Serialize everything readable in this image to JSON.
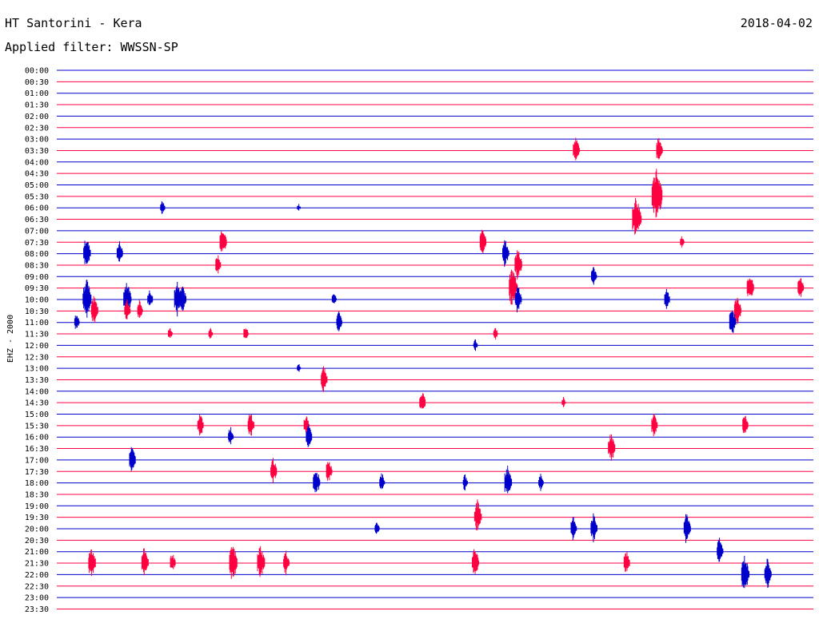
{
  "header": {
    "station": "HT Santorini - Kera",
    "date": "2018-04-02",
    "filter": "Applied filter: WWSSN-SP"
  },
  "chart_data": {
    "type": "line",
    "title": "HT Santorini - Kera",
    "subtitle": "Applied filter: WWSSN-SP",
    "ylabel": "EHZ - 2000",
    "xlabel": "",
    "time_lines": [
      "00:00",
      "00:30",
      "01:00",
      "01:30",
      "02:00",
      "02:30",
      "03:00",
      "03:30",
      "04:00",
      "04:30",
      "05:00",
      "05:30",
      "06:00",
      "06:30",
      "07:00",
      "07:30",
      "08:00",
      "08:30",
      "09:00",
      "09:30",
      "10:00",
      "10:30",
      "11:00",
      "11:30",
      "12:00",
      "12:30",
      "13:00",
      "13:30",
      "14:00",
      "14:30",
      "15:00",
      "15:30",
      "16:00",
      "16:30",
      "17:00",
      "17:30",
      "18:00",
      "18:30",
      "19:00",
      "19:30",
      "20:00",
      "20:30",
      "21:00",
      "21:30",
      "22:00",
      "22:30",
      "23:00",
      "23:30"
    ],
    "line_colors": [
      "#0000cc",
      "#ff0040"
    ],
    "x_range_minutes": [
      0,
      30
    ],
    "grid": false,
    "events": [
      {
        "line": "03:30",
        "minute": 20.6,
        "amp": 1.4
      },
      {
        "line": "03:30",
        "minute": 23.9,
        "amp": 1.3
      },
      {
        "line": "05:30",
        "minute": 23.8,
        "amp": 2.6
      },
      {
        "line": "06:00",
        "minute": 4.2,
        "amp": 0.8
      },
      {
        "line": "06:00",
        "minute": 9.6,
        "amp": 0.4
      },
      {
        "line": "06:30",
        "minute": 23.0,
        "amp": 2.2
      },
      {
        "line": "07:30",
        "minute": 6.6,
        "amp": 1.5
      },
      {
        "line": "07:30",
        "minute": 16.9,
        "amp": 1.3
      },
      {
        "line": "07:30",
        "minute": 24.8,
        "amp": 0.6
      },
      {
        "line": "08:00",
        "minute": 1.2,
        "amp": 1.6
      },
      {
        "line": "08:00",
        "minute": 2.5,
        "amp": 1.2
      },
      {
        "line": "08:00",
        "minute": 17.8,
        "amp": 1.4
      },
      {
        "line": "08:30",
        "minute": 6.4,
        "amp": 1.0
      },
      {
        "line": "08:30",
        "minute": 18.3,
        "amp": 1.6
      },
      {
        "line": "09:00",
        "minute": 21.3,
        "amp": 1.1
      },
      {
        "line": "09:30",
        "minute": 18.1,
        "amp": 2.0
      },
      {
        "line": "09:30",
        "minute": 27.5,
        "amp": 1.5
      },
      {
        "line": "09:30",
        "minute": 29.5,
        "amp": 1.2
      },
      {
        "line": "10:00",
        "minute": 1.2,
        "amp": 2.0
      },
      {
        "line": "10:00",
        "minute": 2.8,
        "amp": 1.8
      },
      {
        "line": "10:00",
        "minute": 3.7,
        "amp": 1.0
      },
      {
        "line": "10:00",
        "minute": 4.8,
        "amp": 1.6
      },
      {
        "line": "10:00",
        "minute": 5.0,
        "amp": 1.4
      },
      {
        "line": "10:00",
        "minute": 11.0,
        "amp": 0.8
      },
      {
        "line": "10:00",
        "minute": 18.3,
        "amp": 1.4
      },
      {
        "line": "10:00",
        "minute": 24.2,
        "amp": 1.0
      },
      {
        "line": "10:30",
        "minute": 1.5,
        "amp": 1.5
      },
      {
        "line": "10:30",
        "minute": 2.8,
        "amp": 1.2
      },
      {
        "line": "10:30",
        "minute": 3.3,
        "amp": 1.0
      },
      {
        "line": "10:30",
        "minute": 27.0,
        "amp": 1.5
      },
      {
        "line": "11:00",
        "minute": 11.2,
        "amp": 1.1
      },
      {
        "line": "11:00",
        "minute": 26.8,
        "amp": 1.4
      },
      {
        "line": "11:00",
        "minute": 0.8,
        "amp": 0.9
      },
      {
        "line": "11:30",
        "minute": 4.5,
        "amp": 0.7
      },
      {
        "line": "11:30",
        "minute": 6.1,
        "amp": 0.6
      },
      {
        "line": "11:30",
        "minute": 7.5,
        "amp": 0.8
      },
      {
        "line": "11:30",
        "minute": 17.4,
        "amp": 0.7
      },
      {
        "line": "12:00",
        "minute": 16.6,
        "amp": 0.6
      },
      {
        "line": "13:00",
        "minute": 9.6,
        "amp": 0.5
      },
      {
        "line": "13:30",
        "minute": 10.6,
        "amp": 1.3
      },
      {
        "line": "14:30",
        "minute": 14.5,
        "amp": 1.2
      },
      {
        "line": "14:30",
        "minute": 20.1,
        "amp": 0.5
      },
      {
        "line": "15:30",
        "minute": 5.7,
        "amp": 1.2
      },
      {
        "line": "15:30",
        "minute": 7.7,
        "amp": 1.3
      },
      {
        "line": "15:30",
        "minute": 9.9,
        "amp": 1.0
      },
      {
        "line": "15:30",
        "minute": 23.7,
        "amp": 1.2
      },
      {
        "line": "15:30",
        "minute": 27.3,
        "amp": 1.1
      },
      {
        "line": "16:00",
        "minute": 6.9,
        "amp": 1.0
      },
      {
        "line": "16:00",
        "minute": 10.0,
        "amp": 1.2
      },
      {
        "line": "16:30",
        "minute": 22.0,
        "amp": 1.5
      },
      {
        "line": "17:00",
        "minute": 3.0,
        "amp": 1.3
      },
      {
        "line": "17:30",
        "minute": 8.6,
        "amp": 1.3
      },
      {
        "line": "17:30",
        "minute": 10.8,
        "amp": 1.2
      },
      {
        "line": "18:00",
        "minute": 10.3,
        "amp": 1.5
      },
      {
        "line": "18:00",
        "minute": 12.9,
        "amp": 1.0
      },
      {
        "line": "18:00",
        "minute": 16.2,
        "amp": 0.8
      },
      {
        "line": "18:00",
        "minute": 17.9,
        "amp": 1.6
      },
      {
        "line": "18:00",
        "minute": 19.2,
        "amp": 0.9
      },
      {
        "line": "19:30",
        "minute": 16.7,
        "amp": 1.6
      },
      {
        "line": "20:00",
        "minute": 12.7,
        "amp": 0.8
      },
      {
        "line": "20:00",
        "minute": 20.5,
        "amp": 1.2
      },
      {
        "line": "20:00",
        "minute": 21.3,
        "amp": 1.4
      },
      {
        "line": "20:00",
        "minute": 25.0,
        "amp": 1.5
      },
      {
        "line": "21:00",
        "minute": 26.3,
        "amp": 1.3
      },
      {
        "line": "21:30",
        "minute": 1.4,
        "amp": 1.6
      },
      {
        "line": "21:30",
        "minute": 3.5,
        "amp": 1.5
      },
      {
        "line": "21:30",
        "minute": 4.6,
        "amp": 1.0
      },
      {
        "line": "21:30",
        "minute": 7.0,
        "amp": 1.8
      },
      {
        "line": "21:30",
        "minute": 8.1,
        "amp": 1.7
      },
      {
        "line": "21:30",
        "minute": 9.1,
        "amp": 1.2
      },
      {
        "line": "21:30",
        "minute": 16.6,
        "amp": 1.5
      },
      {
        "line": "21:30",
        "minute": 22.6,
        "amp": 1.2
      },
      {
        "line": "22:00",
        "minute": 27.3,
        "amp": 1.8
      },
      {
        "line": "22:00",
        "minute": 28.2,
        "amp": 1.5
      }
    ]
  }
}
